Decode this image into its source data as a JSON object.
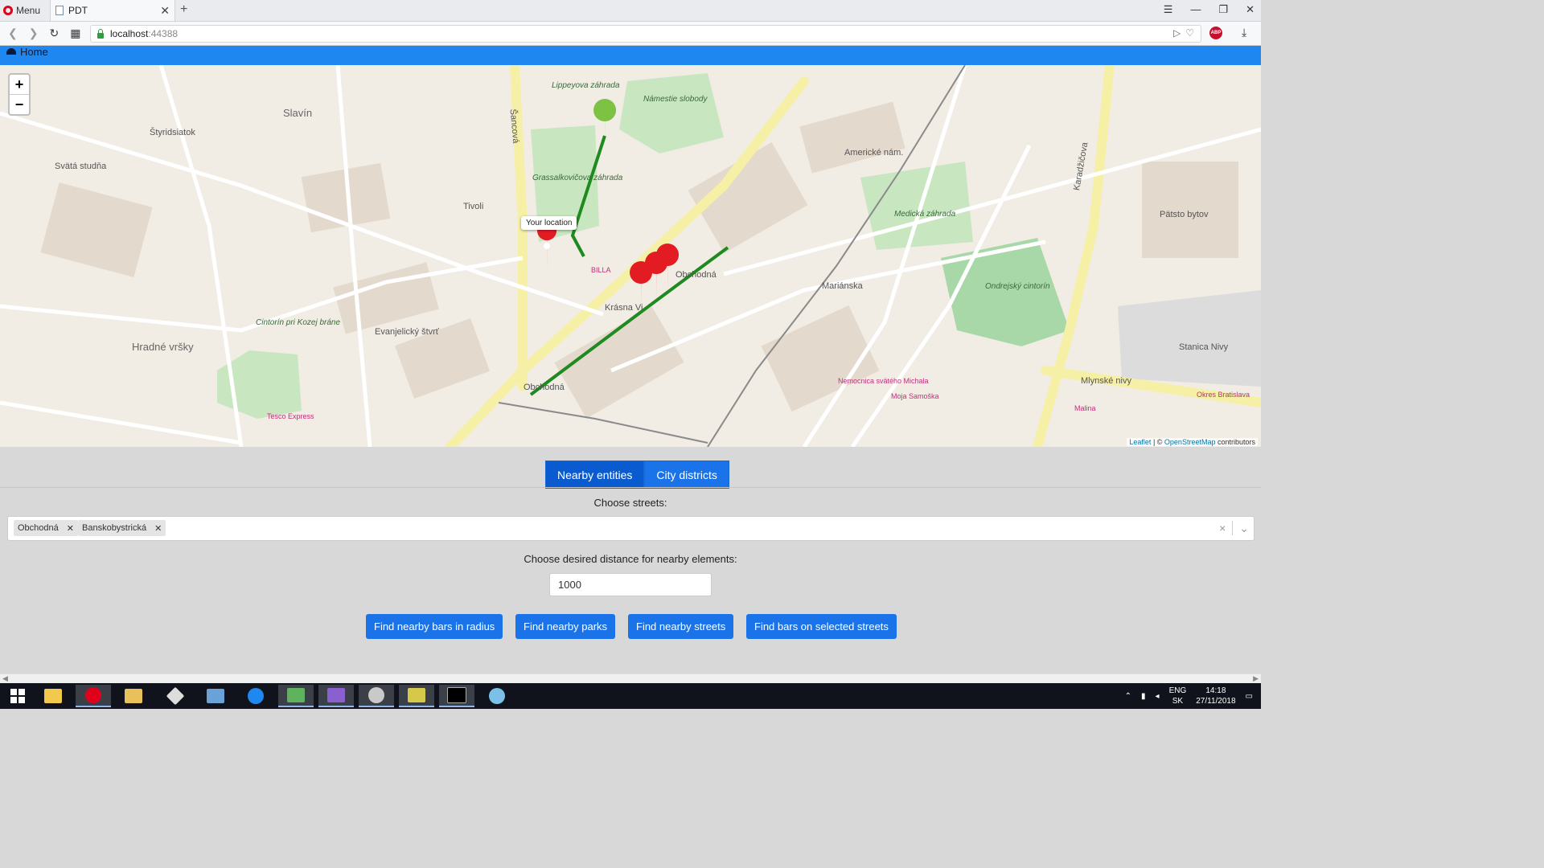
{
  "browser": {
    "menu_label": "Menu",
    "tab_title": "PDT",
    "url_host": "localhost",
    "url_port": ":44388",
    "adblock_label": "ABP"
  },
  "nav": {
    "home_label": "Home"
  },
  "map": {
    "tooltip": "Your location",
    "zoom_in": "+",
    "zoom_out": "−",
    "attribution_leaflet": "Leaflet",
    "attribution_sep": " | © ",
    "attribution_osm": "OpenStreetMap",
    "attribution_tail": " contributors",
    "labels": [
      "Slavín",
      "Štyridsiatok",
      "Svätá studňa",
      "Hradné vršky",
      "Tivoli",
      "Evanjelický štvrť",
      "Grassalkovičova záhrada",
      "Námestie slobody",
      "Lippeyova záhrada",
      "Americké nám.",
      "Medická záhrada",
      "Ondrejský cintorín",
      "Stanica Nivy",
      "Krásna Vi",
      "Mariánska",
      "Obchodná",
      "Obchodná",
      "BILLA",
      "Tesco Express",
      "Nemocnica svätého Michala",
      "Moja Samoška",
      "Malina",
      "Cintorín pri Kozej bráne",
      "Okres Bratislava",
      "Pätsto bytov",
      "Mlynské nivy",
      "Karadžičova",
      "Šancová"
    ]
  },
  "tabs": [
    {
      "label": "Nearby entities",
      "active": true
    },
    {
      "label": "City districts",
      "active": false
    }
  ],
  "streets": {
    "label": "Choose streets:",
    "selected": [
      "Obchodná",
      "Banskobystrická"
    ],
    "clear_icon": "×",
    "dropdown_icon": "⌄"
  },
  "distance": {
    "label": "Choose desired distance for nearby elements:",
    "value": "1000"
  },
  "actions": [
    "Find nearby bars in radius",
    "Find nearby parks",
    "Find nearby streets",
    "Find bars on selected streets"
  ],
  "taskbar": {
    "lang_top": "ENG",
    "lang_bottom": "SK",
    "time": "14:18",
    "date": "27/11/2018"
  },
  "colors": {
    "accent": "#1a73e8",
    "navbar": "#1e88f0",
    "route": "#1f8a1f",
    "marker_red": "#e31b23",
    "marker_green": "#7dc242"
  }
}
